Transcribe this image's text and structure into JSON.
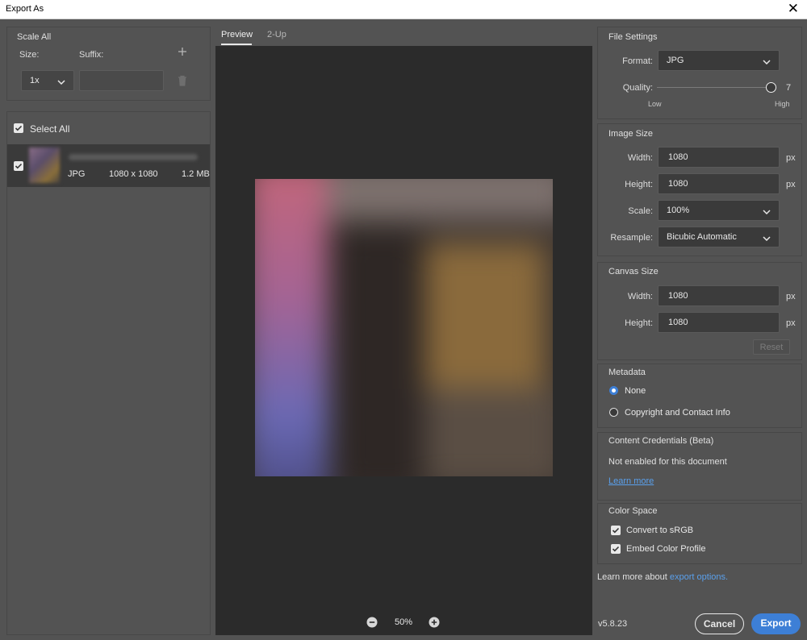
{
  "window": {
    "title": "Export As",
    "close_glyph": "✕"
  },
  "left": {
    "scale_all": "Scale All",
    "size_label": "Size:",
    "suffix_label": "Suffix:",
    "size_value": "1x",
    "suffix_value": "",
    "select_all": "Select All",
    "file": {
      "format": "JPG",
      "dimensions": "1080 x 1080",
      "size": "1.2 MB"
    }
  },
  "preview": {
    "tabs": [
      "Preview",
      "2-Up"
    ],
    "active_tab": "Preview",
    "zoom": "50%"
  },
  "file_settings": {
    "heading": "File Settings",
    "format_label": "Format:",
    "format_value": "JPG",
    "quality_label": "Quality:",
    "quality_value": "7",
    "quality_min": 1,
    "quality_max": 7,
    "low_label": "Low",
    "high_label": "High"
  },
  "image_size": {
    "heading": "Image Size",
    "width_label": "Width:",
    "width_value": "1080",
    "height_label": "Height:",
    "height_value": "1080",
    "unit": "px",
    "scale_label": "Scale:",
    "scale_value": "100%",
    "resample_label": "Resample:",
    "resample_value": "Bicubic Automatic"
  },
  "canvas_size": {
    "heading": "Canvas Size",
    "width_label": "Width:",
    "width_value": "1080",
    "height_label": "Height:",
    "height_value": "1080",
    "unit": "px",
    "reset": "Reset"
  },
  "metadata": {
    "heading": "Metadata",
    "options": [
      "None",
      "Copyright and Contact Info"
    ],
    "selected": "None"
  },
  "content_credentials": {
    "heading": "Content Credentials (Beta)",
    "status": "Not enabled for this document",
    "link": "Learn more"
  },
  "color_space": {
    "heading": "Color Space",
    "convert": "Convert to sRGB",
    "convert_checked": true,
    "embed": "Embed Color Profile",
    "embed_checked": true
  },
  "footer": {
    "learn_prefix": "Learn more about",
    "learn_link": "export options.",
    "version": "v5.8.23",
    "cancel": "Cancel",
    "export": "Export"
  },
  "colors": {
    "accent": "#3d7fd6",
    "link": "#5aa0ec",
    "panel_bg": "#535353",
    "preview_bg": "#2b2b2b"
  }
}
